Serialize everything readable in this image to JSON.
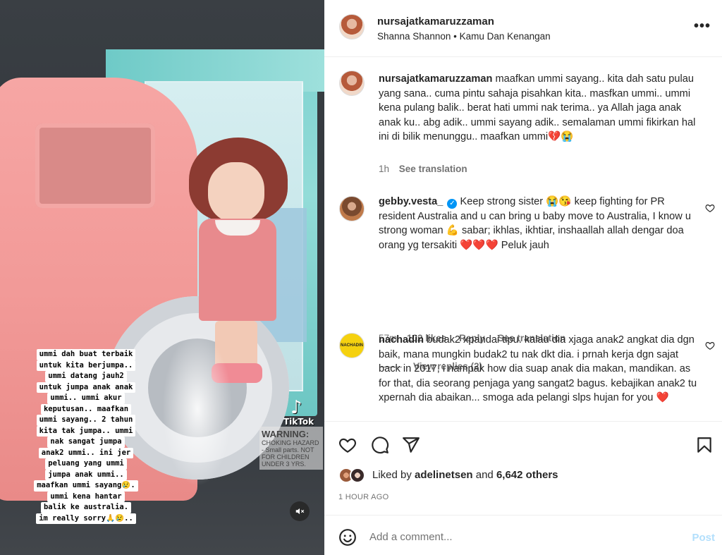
{
  "media": {
    "watermark": "TikTok",
    "warning_title": "WARNING:",
    "warning_text": "CHOKING HAZARD - Small parts. NOT FOR CHILDREN UNDER 3 YRS.",
    "overlay_lines": [
      "ummi dah buat terbaik",
      "untuk kita berjumpa..",
      "ummi datang jauh2",
      "untuk jumpa anak anak",
      "ummi.. ummi akur",
      "keputusan.. maafkan",
      "ummi sayang.. 2 tahun",
      "kita tak jumpa.. ummi",
      "nak sangat jumpa",
      "anak2 ummi.. ini jer",
      "peluang yang ummi",
      "jumpa anak ummi..",
      "maafkan ummi sayang😢.",
      "ummi kena hantar",
      "balik ke australia.",
      "im really sorry🙏😢.."
    ]
  },
  "header": {
    "username": "nursajatkamaruzzaman",
    "audio": "Shanna Shannon • Kamu Dan Kenangan",
    "more_icon": "more-horizontal-icon"
  },
  "comments": [
    {
      "username": "nursajatkamaruzzaman",
      "text": "maafkan ummi sayang.. kita dah satu pulau yang sana.. cuma pintu sahaja pisahkan kita.. masfkan ummi.. ummi kena pulang balik.. berat hati ummi nak terima.. ya Allah jaga anak anak ku.. abg adik.. ummi sayang adik.. semalaman ummi fikirkan hal ini di bilik menunggu.. maafkan ummi💔😭",
      "time": "1h",
      "see_translation": "See translation"
    },
    {
      "username": "gebby.vesta_",
      "text": "Keep strong sister 😭😘 keep fighting for PR resident Australia and u can bring u baby move to Australia, I know u strong woman 💪 sabar; ikhlas, ikhtiar, inshaallah allah dengar doa orang yg tersakiti ❤️❤️❤️ Peluk jauh",
      "time": "57m",
      "likes": "102 likes",
      "reply": "Reply",
      "see_translation": "See translation",
      "view_replies": "View replies (2)"
    },
    {
      "username": "nachadin",
      "avatar_label": "NACHADIN",
      "text": "budak2 xpandai tipu. kalau dia xjaga anak2 angkat dia dgn baik, mana mungkin budak2 tu nak dkt dia. i prnah kerja dgn sajat back in 2017, i nampak how dia suap anak dia makan, mandikan. as for that, dia seorang penjaga yang sangat2 bagus. kebajikan anak2 tu xpernah dia abaikan... smoga ada pelangi slps hujan for you ❤️"
    }
  ],
  "actions": {
    "like_icon": "heart-icon",
    "comment_icon": "comment-icon",
    "share_icon": "send-icon",
    "save_icon": "bookmark-icon"
  },
  "likes": {
    "prefix": "Liked by ",
    "user": "adelinetsen",
    "middle": " and ",
    "others": "6,642 others"
  },
  "time_ago": "1 HOUR AGO",
  "add_comment": {
    "placeholder": "Add a comment...",
    "post_label": "Post"
  },
  "colors": {
    "accent": "#0095f6",
    "post_disabled": "#b2dffc",
    "secondary_text": "#737373",
    "heart_red": "#e0245e"
  }
}
